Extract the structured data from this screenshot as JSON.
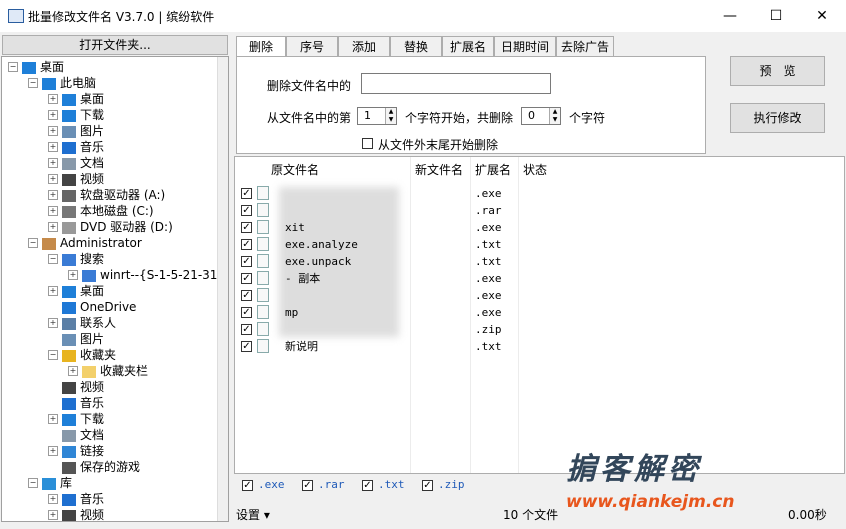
{
  "window": {
    "title": "批量修改文件名 V3.7.0 | 缤纷软件",
    "minimize": "—",
    "maximize": "☐",
    "close": "✕"
  },
  "tree": {
    "open_button": "打开文件夹...",
    "nodes": [
      {
        "label": "桌面",
        "level": 0,
        "expander": "−",
        "icon": "desktop-icon"
      },
      {
        "label": "此电脑",
        "level": 1,
        "expander": "−",
        "icon": "computer-icon"
      },
      {
        "label": "桌面",
        "level": 2,
        "expander": "+",
        "icon": "desktop-icon"
      },
      {
        "label": "下载",
        "level": 2,
        "expander": "+",
        "icon": "download-icon"
      },
      {
        "label": "图片",
        "level": 2,
        "expander": "+",
        "icon": "pictures-icon"
      },
      {
        "label": "音乐",
        "level": 2,
        "expander": "+",
        "icon": "music-icon"
      },
      {
        "label": "文档",
        "level": 2,
        "expander": "+",
        "icon": "document-icon"
      },
      {
        "label": "视频",
        "level": 2,
        "expander": "+",
        "icon": "video-icon"
      },
      {
        "label": "软盘驱动器 (A:)",
        "level": 2,
        "expander": "+",
        "icon": "floppy-icon"
      },
      {
        "label": "本地磁盘 (C:)",
        "level": 2,
        "expander": "+",
        "icon": "disk-icon"
      },
      {
        "label": "DVD 驱动器 (D:)",
        "level": 2,
        "expander": "+",
        "icon": "dvd-icon"
      },
      {
        "label": "Administrator",
        "level": 1,
        "expander": "−",
        "icon": "user-icon"
      },
      {
        "label": "搜索",
        "level": 2,
        "expander": "−",
        "icon": "search-icon"
      },
      {
        "label": "winrt--{S-1-5-21-31",
        "level": 3,
        "expander": "+",
        "icon": "search-icon"
      },
      {
        "label": "桌面",
        "level": 2,
        "expander": "+",
        "icon": "desktop-icon"
      },
      {
        "label": "OneDrive",
        "level": 2,
        "expander": "",
        "icon": "cloud-icon"
      },
      {
        "label": "联系人",
        "level": 2,
        "expander": "+",
        "icon": "contacts-icon"
      },
      {
        "label": "图片",
        "level": 2,
        "expander": "",
        "icon": "pictures-icon"
      },
      {
        "label": "收藏夹",
        "level": 2,
        "expander": "−",
        "icon": "star-icon"
      },
      {
        "label": "收藏夹栏",
        "level": 3,
        "expander": "+",
        "icon": "folder-icon"
      },
      {
        "label": "视频",
        "level": 2,
        "expander": "",
        "icon": "video-icon"
      },
      {
        "label": "音乐",
        "level": 2,
        "expander": "",
        "icon": "music-icon"
      },
      {
        "label": "下载",
        "level": 2,
        "expander": "+",
        "icon": "download-icon"
      },
      {
        "label": "文档",
        "level": 2,
        "expander": "",
        "icon": "document-icon"
      },
      {
        "label": "链接",
        "level": 2,
        "expander": "+",
        "icon": "link-icon"
      },
      {
        "label": "保存的游戏",
        "level": 2,
        "expander": "",
        "icon": "game-icon"
      },
      {
        "label": "库",
        "level": 1,
        "expander": "−",
        "icon": "library-icon"
      },
      {
        "label": "音乐",
        "level": 2,
        "expander": "+",
        "icon": "music-icon"
      },
      {
        "label": "视频",
        "level": 2,
        "expander": "+",
        "icon": "video-icon"
      }
    ]
  },
  "tabs": [
    "删除",
    "序号",
    "添加",
    "替换",
    "扩展名",
    "日期时间",
    "去除广告"
  ],
  "delete_panel": {
    "field1_label": "删除文件名中的",
    "field1_value": "",
    "range_prefix": "从文件名中的第",
    "start_value": "1",
    "range_mid": "个字符开始，共删除",
    "count_value": "0",
    "range_suffix": "个字符",
    "from_end_label": "从文件外末尾开始删除",
    "from_end_checked": false
  },
  "buttons": {
    "preview": "预　览",
    "execute": "执行修改"
  },
  "list": {
    "headers": [
      "原文件名",
      "新文件名",
      "扩展名",
      "状态"
    ],
    "rows": [
      {
        "name": "",
        "ext": ".exe"
      },
      {
        "name": "",
        "ext": ".rar"
      },
      {
        "name": "xit",
        "ext": ".exe"
      },
      {
        "name": "exe.analyze",
        "ext": ".txt"
      },
      {
        "name": "exe.unpack",
        "ext": ".txt"
      },
      {
        "name": "- 副本",
        "ext": ".exe"
      },
      {
        "name": "",
        "ext": ".exe"
      },
      {
        "name": "mp",
        "ext": ".exe"
      },
      {
        "name": "",
        "ext": ".zip"
      },
      {
        "name": "新说明",
        "ext": ".txt"
      }
    ]
  },
  "filters": [
    ".exe",
    ".rar",
    ".txt",
    ".zip"
  ],
  "status": {
    "settings": "设置 ▾",
    "file_count": "10 个文件",
    "time": "0.00秒"
  },
  "watermark": {
    "text": "掮客解密",
    "url": "www.qiankejm.cn"
  }
}
